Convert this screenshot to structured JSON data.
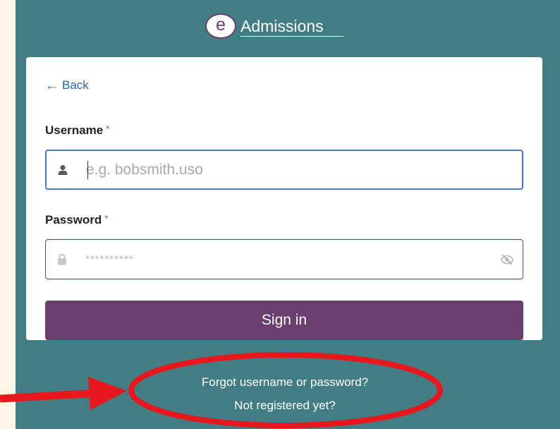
{
  "brand": {
    "logo_letter": "e",
    "name": "Admissions"
  },
  "login": {
    "back_label": "Back",
    "username": {
      "label": "Username",
      "required_mark": "*",
      "placeholder": "e.g. bobsmith.uso",
      "value": ""
    },
    "password": {
      "label": "Password",
      "required_mark": "*",
      "placeholder": "**********",
      "value": ""
    },
    "submit_label": "Sign in"
  },
  "help": {
    "forgot_label": "Forgot username or password?",
    "register_label": "Not registered yet?"
  },
  "colors": {
    "page_background": "#427d84",
    "primary_purple": "#6a3f70",
    "link_blue": "#2a64b4",
    "annotation_red": "#e8171d"
  },
  "icons": {
    "back": "arrow-left-icon",
    "username": "user-icon",
    "password": "lock-icon",
    "toggle_visibility": "eye-slash-icon"
  }
}
